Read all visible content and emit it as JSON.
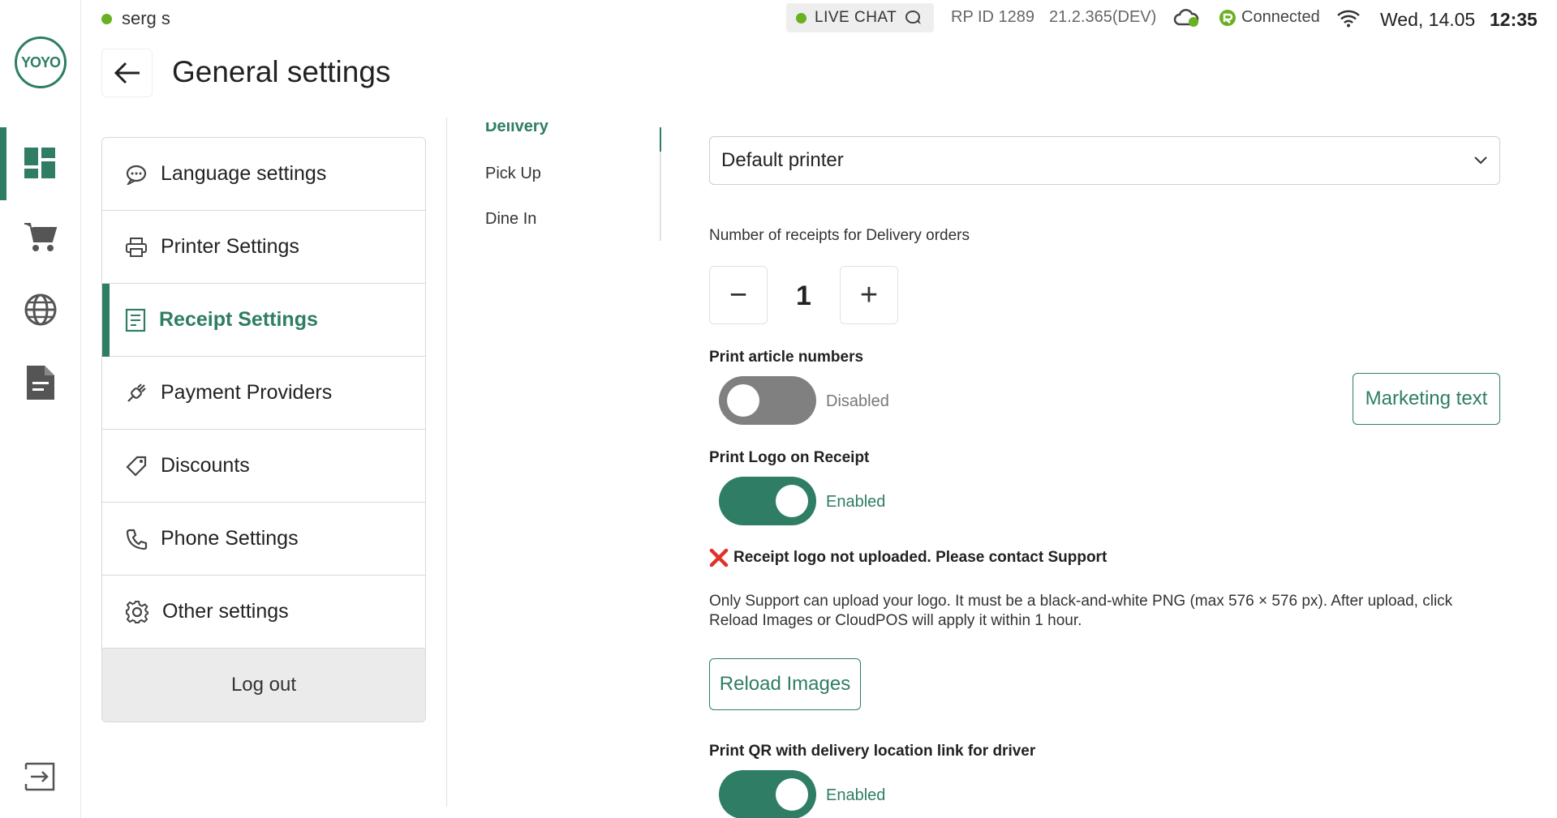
{
  "colors": {
    "accent": "#2e7d64",
    "online": "#6ab023",
    "toggle_off": "#808080",
    "error": "#e0312a"
  },
  "rail": {
    "logo_text": "YOYO",
    "items": [
      {
        "icon": "dashboard-icon",
        "active": true
      },
      {
        "icon": "cart-icon",
        "active": false
      },
      {
        "icon": "globe-icon",
        "active": false
      },
      {
        "icon": "document-icon",
        "active": false
      }
    ],
    "exit_icon": "exit-icon"
  },
  "status": {
    "user": "serg s",
    "live_chat": "LIVE CHAT",
    "rp_id": "RP ID 1289",
    "version": "21.2.365(DEV)",
    "connection": "Connected",
    "date": "Wed, 14.05",
    "time": "12:35"
  },
  "header": {
    "title": "General settings"
  },
  "menu": {
    "items": [
      {
        "label": "Language settings",
        "icon": "chat-icon"
      },
      {
        "label": "Printer Settings",
        "icon": "printer-icon"
      },
      {
        "label": "Receipt Settings",
        "icon": "receipt-icon",
        "active": true
      },
      {
        "label": "Payment Providers",
        "icon": "plug-icon"
      },
      {
        "label": "Discounts",
        "icon": "tag-icon"
      },
      {
        "label": "Phone Settings",
        "icon": "phone-icon"
      },
      {
        "label": "Other settings",
        "icon": "gear-icon"
      }
    ],
    "logout": "Log out"
  },
  "subtabs": {
    "active": "Delivery",
    "items": [
      "Pick Up",
      "Dine In"
    ]
  },
  "content": {
    "printer_select": "Default printer",
    "receipts_label": "Number of receipts for Delivery orders",
    "receipts_count": "1",
    "stepper_minus": "−",
    "stepper_plus": "+",
    "article_numbers": {
      "label": "Print article numbers",
      "state": "Disabled",
      "enabled": false
    },
    "marketing_text": "Marketing text",
    "print_logo": {
      "label": "Print Logo on Receipt",
      "state": "Enabled",
      "enabled": true
    },
    "logo_error": "Receipt logo not uploaded. Please contact Support",
    "logo_info": "Only Support can upload your logo. It must be a black-and-white PNG (max 576 × 576 px). After upload, click Reload Images or CloudPOS will apply it within 1 hour.",
    "reload_images": "Reload Images",
    "print_qr": {
      "label": "Print QR with delivery location link for driver",
      "state": "Enabled",
      "enabled": true
    }
  }
}
